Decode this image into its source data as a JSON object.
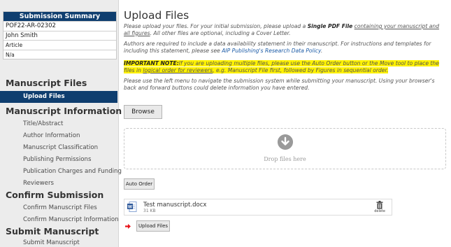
{
  "summary": {
    "title": "Submission Summary",
    "manuscript_id": "POF22-AR-02302",
    "author": "John Smith",
    "type": "Article",
    "extra": "N/a"
  },
  "nav": {
    "manuscript_files": {
      "title": "Manuscript Files",
      "items": [
        "Upload Files"
      ]
    },
    "manuscript_information": {
      "title": "Manuscript Information",
      "items": [
        "Title/Abstract",
        "Author Information",
        "Manuscript Classification",
        "Publishing Permissions",
        "Publication Charges and Funding",
        "Reviewers"
      ]
    },
    "confirm_submission": {
      "title": "Confirm Submission",
      "items": [
        "Confirm Manuscript Files",
        "Confirm Manuscript Information"
      ]
    },
    "submit_manuscript": {
      "title": "Submit Manuscript",
      "items": [
        "Submit Manuscript"
      ]
    }
  },
  "main": {
    "title": "Upload Files",
    "intro": {
      "p1": "Please upload your files. For your initial submission, please upload a ",
      "p1_bold": "Single PDF File",
      "p1_space": " ",
      "p1_underline": "containing your manuscript and all figures",
      "p1_end": ". All other files are optional, including a Cover Letter."
    },
    "data_statement": {
      "text": "Authors are required to include a data availability statement in their manuscript. For instructions and templates for including this statement, please see ",
      "link": "AIP Publishing's Research Data Policy",
      "end": "."
    },
    "important": {
      "label": "IMPORTANT NOTE:",
      "text": "If you are uploading multiple files, please use the Auto Order button or the Move tool to place the files in ",
      "underline": "logical order for reviewers",
      "end": ", e.g. Manuscript File first, followed by Figures in sequential order."
    },
    "nav_note": "Please use the left menu to navigate the submission system while submitting your manuscript. Using your browser's back and forward buttons could delete information you have entered.",
    "browse_label": "Browse",
    "drop_text": "Drop files here",
    "auto_order_label": "Auto Order",
    "file": {
      "name": "Test manuscript.docx",
      "size": "31 KB",
      "delete_label": "delete"
    },
    "upload_label": "Upload Files"
  },
  "colors": {
    "nav_active": "#0f3e6f",
    "highlight": "#fff200",
    "link": "#1a5aa6",
    "arrow": "#e8141b"
  }
}
